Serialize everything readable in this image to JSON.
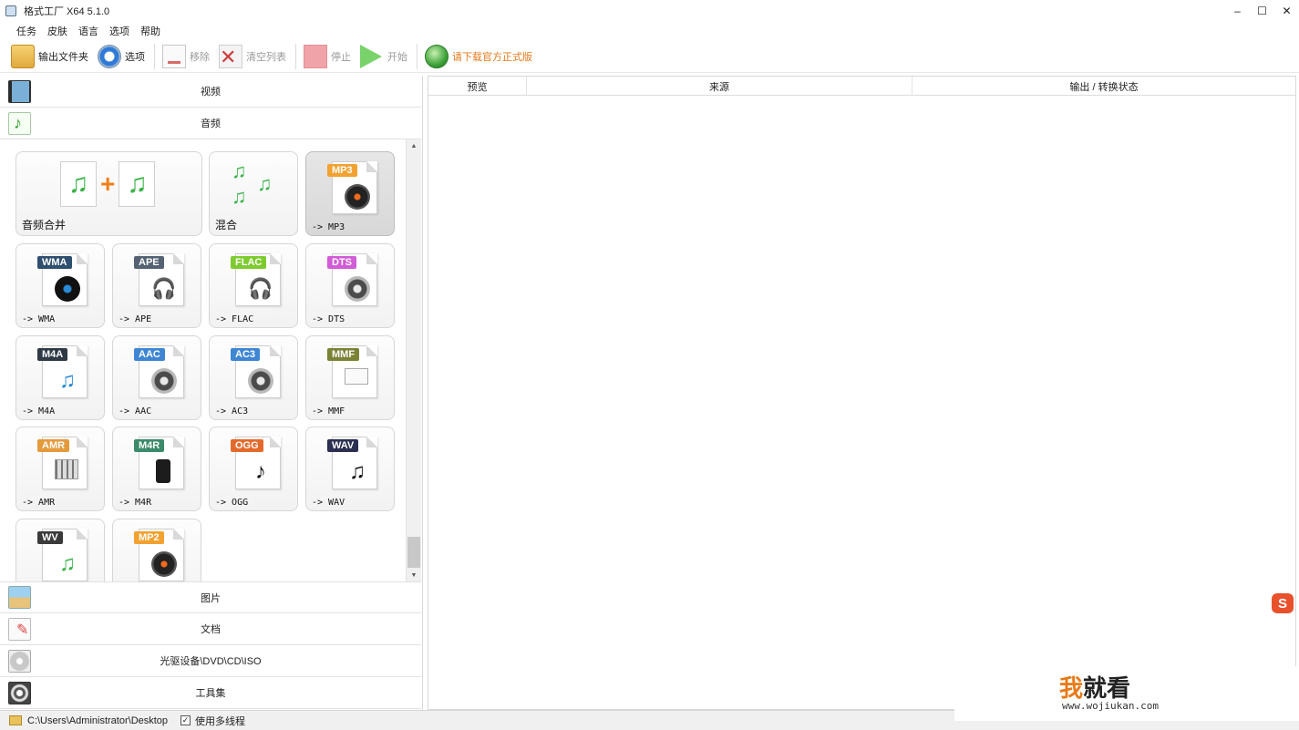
{
  "window": {
    "title": "格式工厂 X64 5.1.0",
    "controls": {
      "minimize": "–",
      "maximize": "☐",
      "close": "✕"
    }
  },
  "menu": [
    "任务",
    "皮肤",
    "语言",
    "选项",
    "帮助"
  ],
  "toolbar": {
    "output_folder": "输出文件夹",
    "options": "选项",
    "remove": "移除",
    "clear_list": "清空列表",
    "stop": "停止",
    "start": "开始",
    "download_official": "请下载官方正式版"
  },
  "categories": {
    "video": "视频",
    "audio": "音频",
    "image": "图片",
    "document": "文档",
    "disc": "光驱设备\\DVD\\CD\\ISO",
    "tools": "工具集"
  },
  "audio_tiles": [
    {
      "label": "音频合并"
    },
    {
      "label": "混合"
    },
    {
      "label": "-> MP3",
      "badge": "MP3",
      "badge_color": "#f2a230",
      "selected": true
    },
    {
      "label": "-> WMA",
      "badge": "WMA",
      "badge_color": "#2e4f6e"
    },
    {
      "label": "-> APE",
      "badge": "APE",
      "badge_color": "#546273"
    },
    {
      "label": "-> FLAC",
      "badge": "FLAC",
      "badge_color": "#7dcb2e"
    },
    {
      "label": "-> DTS",
      "badge": "DTS",
      "badge_color": "#d25bd6"
    },
    {
      "label": "-> M4A",
      "badge": "M4A",
      "badge_color": "#2d3a45"
    },
    {
      "label": "-> AAC",
      "badge": "AAC",
      "badge_color": "#3e86d4"
    },
    {
      "label": "-> AC3",
      "badge": "AC3",
      "badge_color": "#3e86d4"
    },
    {
      "label": "-> MMF",
      "badge": "MMF",
      "badge_color": "#7c8235"
    },
    {
      "label": "-> AMR",
      "badge": "AMR",
      "badge_color": "#e59a3c"
    },
    {
      "label": "-> M4R",
      "badge": "M4R",
      "badge_color": "#3c8a6a"
    },
    {
      "label": "-> OGG",
      "badge": "OGG",
      "badge_color": "#e46a2c"
    },
    {
      "label": "-> WAV",
      "badge": "WAV",
      "badge_color": "#2b2f52"
    },
    {
      "label": "",
      "badge": "WV",
      "badge_color": "#3a3a3a"
    },
    {
      "label": "",
      "badge": "MP2",
      "badge_color": "#f2a230"
    }
  ],
  "table": {
    "columns": [
      "预览",
      "来源",
      "输出 / 转换状态"
    ]
  },
  "statusbar": {
    "path": "C:\\Users\\Administrator\\Desktop",
    "multithread_checked": "✓",
    "multithread_label": "使用多线程"
  },
  "watermark": {
    "brand_first": "我",
    "brand_rest": "就看",
    "url": "www.wojiukan.com"
  },
  "tray": {
    "ime": "S"
  }
}
